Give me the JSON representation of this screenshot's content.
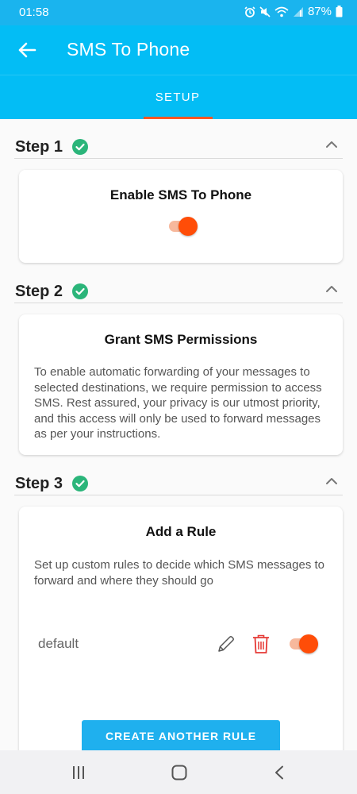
{
  "status_bar": {
    "time": "01:58",
    "battery": "87%",
    "icons": [
      "alarm-icon",
      "mute-icon",
      "wifi-icon",
      "signal-icon",
      "battery-icon"
    ]
  },
  "app_bar": {
    "title": "SMS To Phone",
    "back_icon": "arrow-left-icon"
  },
  "tabs": [
    {
      "label": "SETUP",
      "selected": true
    }
  ],
  "steps": [
    {
      "title": "Step 1",
      "completed": true,
      "expanded": true,
      "card": {
        "title": "Enable SMS To Phone",
        "toggle_on": true
      }
    },
    {
      "title": "Step 2",
      "completed": true,
      "expanded": true,
      "card": {
        "title": "Grant SMS Permissions",
        "body": "To enable automatic forwarding of your messages to selected destinations, we require permission to access SMS. Rest assured, your privacy is our utmost priority, and this access will only be used to forward messages as per your instructions."
      }
    },
    {
      "title": "Step 3",
      "completed": true,
      "expanded": true,
      "card": {
        "title": "Add a Rule",
        "body": "Set up custom rules to decide which SMS messages to forward and where they should go",
        "rules": [
          {
            "name": "default",
            "enabled": true
          }
        ],
        "create_button": "CREATE ANOTHER RULE"
      }
    }
  ],
  "colors": {
    "status_bar": "#1ab4ee",
    "app_bar": "#03bdf5",
    "accent": "#ff4d08",
    "check": "#2bb57a",
    "delete": "#e53935"
  },
  "nav_bar": {
    "icons": [
      "recents-icon",
      "home-icon",
      "back-icon"
    ]
  }
}
